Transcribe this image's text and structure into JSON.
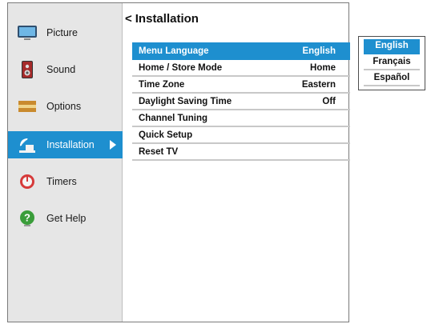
{
  "sidebar": {
    "items": [
      {
        "label": "Picture",
        "icon": "tv-icon",
        "selected": false
      },
      {
        "label": "Sound",
        "icon": "speaker-icon",
        "selected": false
      },
      {
        "label": "Options",
        "icon": "options-icon",
        "selected": false
      },
      {
        "label": "Installation",
        "icon": "satellite-dish-icon",
        "selected": true
      },
      {
        "label": "Timers",
        "icon": "timer-icon",
        "selected": false
      },
      {
        "label": "Get Help",
        "icon": "help-icon",
        "selected": false
      }
    ]
  },
  "panel": {
    "back_glyph": "<",
    "title": "Installation",
    "rows": [
      {
        "label": "Menu Language",
        "value": "English",
        "selected": true
      },
      {
        "label": "Home / Store Mode",
        "value": "Home",
        "selected": false
      },
      {
        "label": "Time Zone",
        "value": "Eastern",
        "selected": false
      },
      {
        "label": "Daylight Saving Time",
        "value": "Off",
        "selected": false
      },
      {
        "label": "Channel Tuning",
        "value": "",
        "selected": false
      },
      {
        "label": "Quick Setup",
        "value": "",
        "selected": false
      },
      {
        "label": "Reset TV",
        "value": "",
        "selected": false
      }
    ]
  },
  "language_dropdown": {
    "options": [
      {
        "label": "English",
        "selected": true
      },
      {
        "label": "Français",
        "selected": false
      },
      {
        "label": "Español",
        "selected": false
      }
    ]
  },
  "colors": {
    "accent": "#1e8fcf",
    "sidebar_bg": "#e6e6e6",
    "divider": "#c8c8c8"
  }
}
